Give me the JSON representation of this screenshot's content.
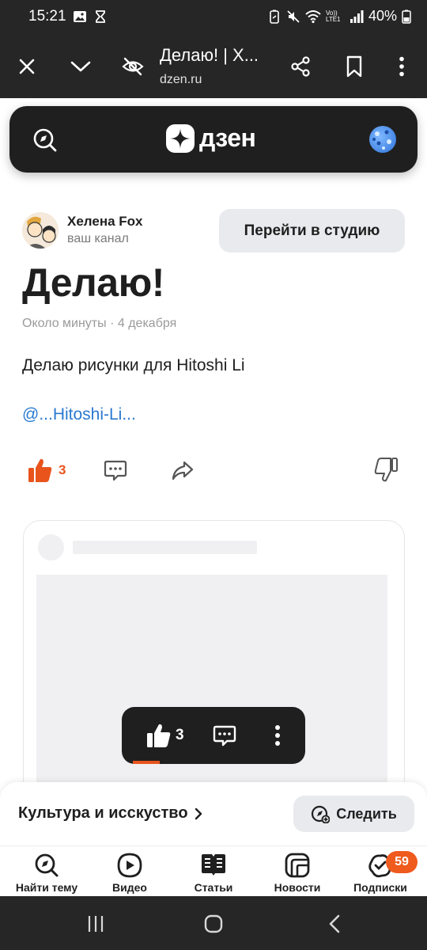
{
  "status_bar": {
    "time": "15:21",
    "battery": "40%",
    "volte": "Vo)) LTE1"
  },
  "browser": {
    "page_title": "Делаю! | Х...",
    "url": "dzen.ru",
    "icons": [
      "close-icon",
      "chevron-down-icon",
      "eye-off-icon",
      "share-icon",
      "bookmark-icon",
      "more-vertical-icon"
    ]
  },
  "dzen_header": {
    "logo_text": "дзен"
  },
  "channel": {
    "name": "Хелена Fox",
    "subtitle": "ваш канал",
    "studio_button": "Перейти в студию"
  },
  "article": {
    "title": "Делаю!",
    "read_time": "Около минуты",
    "separator": "·",
    "date": "4 декабря",
    "text": "Делаю рисунки для Hitoshi Li",
    "link": "@...Hitoshi-Li..."
  },
  "reactions": {
    "like_count": "3"
  },
  "floating_bar": {
    "like_count": "3"
  },
  "category_bar": {
    "category": "Культура и исскуство",
    "follow_button": "Следить"
  },
  "bottom_nav": {
    "items": [
      {
        "label": "Найти тему",
        "icon": "compass-icon"
      },
      {
        "label": "Видео",
        "icon": "video-play-icon"
      },
      {
        "label": "Статьи",
        "icon": "articles-icon"
      },
      {
        "label": "Новости",
        "icon": "news-icon"
      },
      {
        "label": "Подписки",
        "icon": "subscriptions-icon"
      }
    ],
    "subscriptions_badge": "59"
  },
  "colors": {
    "accent": "#e8541c",
    "link": "#2a7ad1",
    "dark_bar": "#262626",
    "header_bg": "#1f1f1f",
    "button_bg": "#e9eaee"
  }
}
